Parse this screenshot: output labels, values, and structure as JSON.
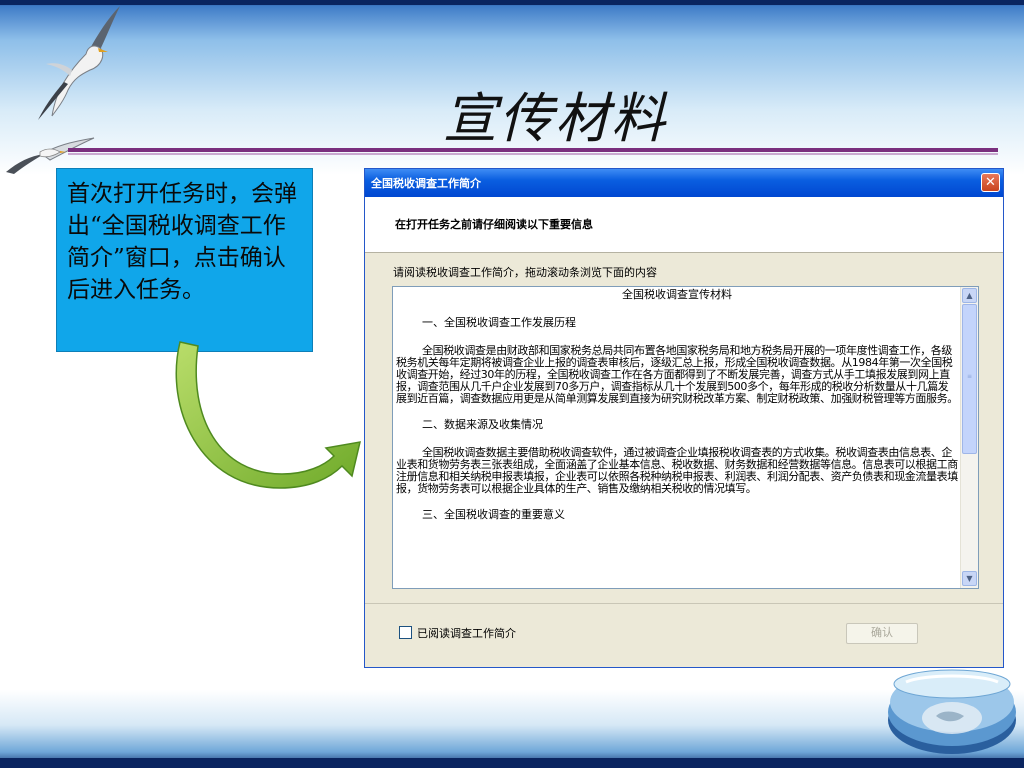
{
  "slide": {
    "title": "宣传材料",
    "callout_text": "首次打开任务时，会弹出“全国税收调查工作简介”窗口，点击确认后进入任务。"
  },
  "dialog": {
    "title": "全国税收调查工作简介",
    "close_symbol": "✕",
    "header": "在打开任务之前请仔细阅读以下重要信息",
    "instruction": "请阅读税收调查工作简介，拖动滚动条浏览下面的内容",
    "document": {
      "title": "全国税收调查宣传材料",
      "section1": "一、全国税收调查工作发展历程",
      "para1": "全国税收调查是由财政部和国家税务总局共同布置各地国家税务局和地方税务局开展的一项年度性调查工作，各级税务机关每年定期将被调查企业上报的调查表审核后，逐级汇总上报，形成全国税收调查数据。从1984年第一次全国税收调查开始，经过30年的历程，全国税收调查工作在各方面都得到了不断发展完善，调查方式从手工填报发展到网上直报，调查范围从几千户企业发展到70多万户，调查指标从几十个发展到500多个，每年形成的税收分析数量从十几篇发展到近百篇，调查数据应用更是从简单测算发展到直接为研究财税改革方案、制定财税政策、加强财税管理等方面服务。",
      "section2": "二、数据来源及收集情况",
      "para2": "全国税收调查数据主要借助税收调查软件，通过被调查企业填报税收调查表的方式收集。税收调查表由信息表、企业表和货物劳务表三张表组成，全面涵盖了企业基本信息、税收数据、财务数据和经营数据等信息。信息表可以根据工商注册信息和相关纳税申报表填报，企业表可以依照各税种纳税申报表、利润表、利润分配表、资产负债表和现金流量表填报，货物劳务表可以根据企业具体的生产、销售及缴纳相关税收的情况填写。",
      "section3": "三、全国税收调查的重要意义"
    },
    "scroll_up": "▲",
    "scroll_down": "▼",
    "checkbox_label": "已阅读调查工作简介",
    "checkbox_checked": false,
    "ok_label": "确认",
    "ok_enabled": false
  },
  "icons": [
    "seagull-icon",
    "curved-arrow-icon",
    "globe-icon",
    "close-icon",
    "scroll-up-icon",
    "scroll-down-icon"
  ],
  "colors": {
    "callout_bg": "#10a6ea",
    "title_rule": "#7a2f7e",
    "dialog_title_bar": "#0a5ee0",
    "arrow": "#8cc63f"
  }
}
